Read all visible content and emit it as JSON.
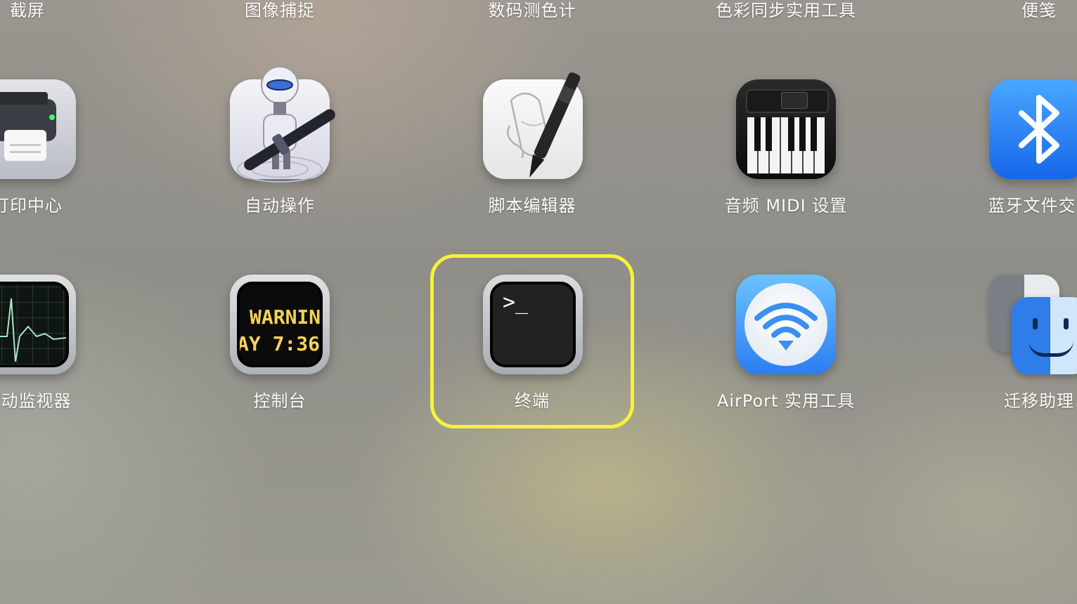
{
  "top_row": [
    "截屏",
    "图像捕捉",
    "数码测色计",
    "色彩同步实用工具",
    "便笺"
  ],
  "middle_row": [
    {
      "label": "打印中心",
      "icon": "printer-icon"
    },
    {
      "label": "自动操作",
      "icon": "automator-robot-icon"
    },
    {
      "label": "脚本编辑器",
      "icon": "script-editor-pen-icon"
    },
    {
      "label": "音频 MIDI 设置",
      "icon": "piano-keyboard-icon"
    },
    {
      "label": "蓝牙文件交",
      "icon": "bluetooth-icon"
    }
  ],
  "bottom_row": [
    {
      "label": "活动监视器",
      "icon": "activity-monitor-icon"
    },
    {
      "label": "控制台",
      "icon": "console-warning-icon"
    },
    {
      "label": "终端",
      "icon": "terminal-icon"
    },
    {
      "label": "AirPort 实用工具",
      "icon": "airport-wifi-icon"
    },
    {
      "label": "迁移助理",
      "icon": "finder-face-icon"
    }
  ],
  "console_screen": {
    "line1": "WARNIN",
    "line2": "AY 7:36"
  },
  "terminal_screen": {
    "prompt": ">_"
  },
  "highlight": {
    "target": "终端",
    "color": "#f7f23a"
  }
}
